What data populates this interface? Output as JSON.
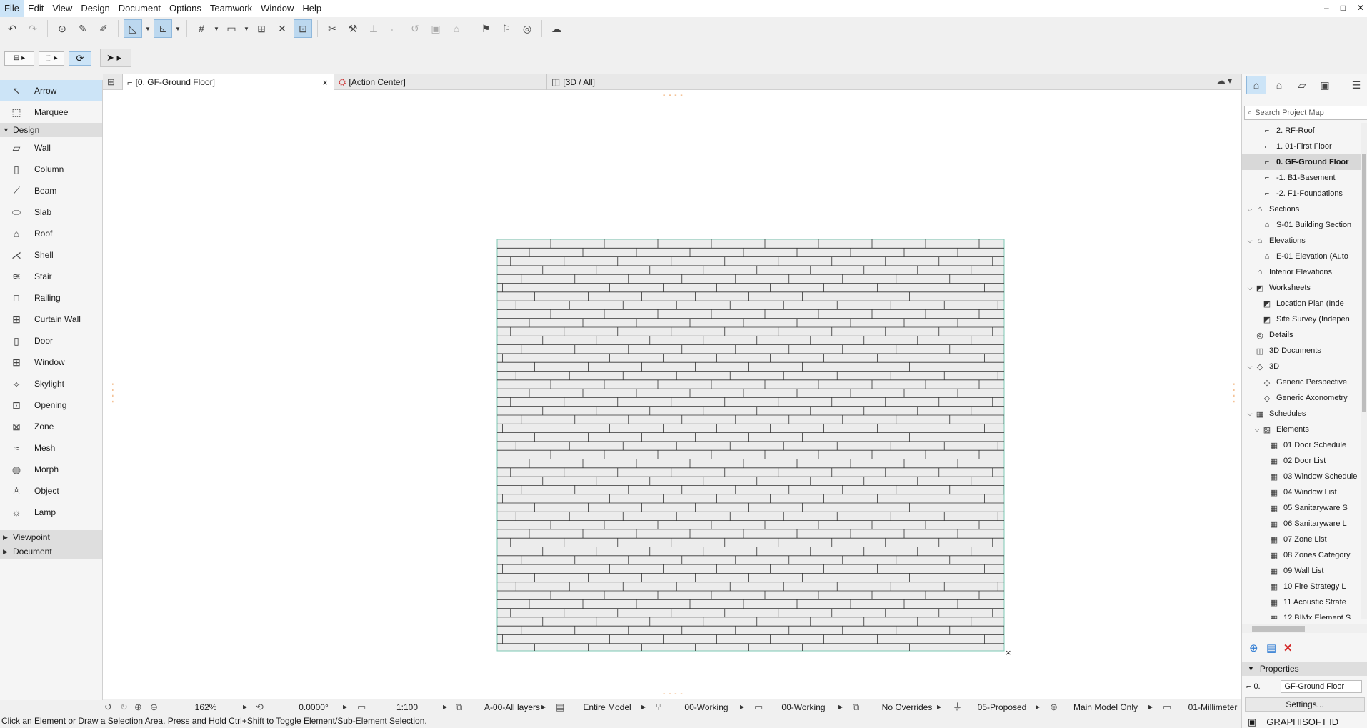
{
  "menu": [
    "File",
    "Edit",
    "View",
    "Design",
    "Document",
    "Options",
    "Teamwork",
    "Window",
    "Help"
  ],
  "window_controls": [
    "–",
    "□",
    "✕"
  ],
  "toolbar": {
    "undo": "undo-icon",
    "redo": "redo-icon"
  },
  "toolbox": {
    "top_tools": [
      "Arrow",
      "Marquee"
    ],
    "design_group": "Design",
    "design_tools": [
      "Wall",
      "Column",
      "Beam",
      "Slab",
      "Roof",
      "Shell",
      "Stair",
      "Railing",
      "Curtain Wall",
      "Door",
      "Window",
      "Skylight",
      "Opening",
      "Zone",
      "Mesh",
      "Morph",
      "Object",
      "Lamp"
    ],
    "collapsed_groups": [
      "Viewpoint",
      "Document"
    ]
  },
  "tabs": [
    {
      "label": "[0. GF-Ground Floor]",
      "close": "×"
    },
    {
      "label": "[Action Center]"
    },
    {
      "label": "[3D / All]"
    }
  ],
  "status": {
    "zoom": "162%",
    "angle": "0.0000°",
    "scale": "1:100",
    "layers": "A-00-All layers",
    "model": "Entire Model",
    "pen_set": "00-Working",
    "model_view": "00-Working",
    "overrides": "No Overrides",
    "renovation": "05-Proposed",
    "structure": "Main Model Only",
    "dimension": "01-Millimeter"
  },
  "hint": "Click an Element or Draw a Selection Area. Press and Hold Ctrl+Shift to Toggle Element/Sub-Element Selection.",
  "project_map": {
    "search_placeholder": "Search Project Map",
    "items": [
      {
        "label": "2. RF-Roof",
        "indent": 2
      },
      {
        "label": "1. 01-First Floor",
        "indent": 2
      },
      {
        "label": "0. GF-Ground Floor",
        "indent": 2,
        "selected": true
      },
      {
        "label": "-1. B1-Basement",
        "indent": 2
      },
      {
        "label": "-2. F1-Foundations",
        "indent": 2
      },
      {
        "label": "Sections",
        "indent": 1,
        "expanded": true
      },
      {
        "label": "S-01 Building Section",
        "indent": 2
      },
      {
        "label": "Elevations",
        "indent": 1,
        "expanded": true
      },
      {
        "label": "E-01 Elevation (Auto",
        "indent": 2
      },
      {
        "label": "Interior Elevations",
        "indent": 1
      },
      {
        "label": "Worksheets",
        "indent": 1,
        "expanded": true
      },
      {
        "label": "Location Plan (Inde",
        "indent": 2
      },
      {
        "label": "Site Survey (Indepen",
        "indent": 2
      },
      {
        "label": "Details",
        "indent": 1
      },
      {
        "label": "3D Documents",
        "indent": 1
      },
      {
        "label": "3D",
        "indent": 1,
        "expanded": true
      },
      {
        "label": "Generic Perspective",
        "indent": 2
      },
      {
        "label": "Generic Axonometry",
        "indent": 2
      },
      {
        "label": "Schedules",
        "indent": 1,
        "expanded": true
      },
      {
        "label": "Elements",
        "indent": 2,
        "expanded": true
      },
      {
        "label": "01 Door Schedule",
        "indent": 3
      },
      {
        "label": "02 Door List",
        "indent": 3
      },
      {
        "label": "03 Window Schedule",
        "indent": 3
      },
      {
        "label": "04 Window List",
        "indent": 3
      },
      {
        "label": "05 Sanitaryware S",
        "indent": 3
      },
      {
        "label": "06 Sanitaryware L",
        "indent": 3
      },
      {
        "label": "07 Zone List",
        "indent": 3
      },
      {
        "label": "08 Zones Category",
        "indent": 3
      },
      {
        "label": "09 Wall List",
        "indent": 3
      },
      {
        "label": "10 Fire Strategy L",
        "indent": 3
      },
      {
        "label": "11 Acoustic Strate",
        "indent": 3
      },
      {
        "label": "12 BIMx Element S",
        "indent": 3
      }
    ]
  },
  "properties": {
    "header": "Properties",
    "story_number": "0.",
    "story_name": "GF-Ground Floor",
    "settings_button": "Settings..."
  },
  "graphisoft_id": "GRAPHISOFT ID"
}
